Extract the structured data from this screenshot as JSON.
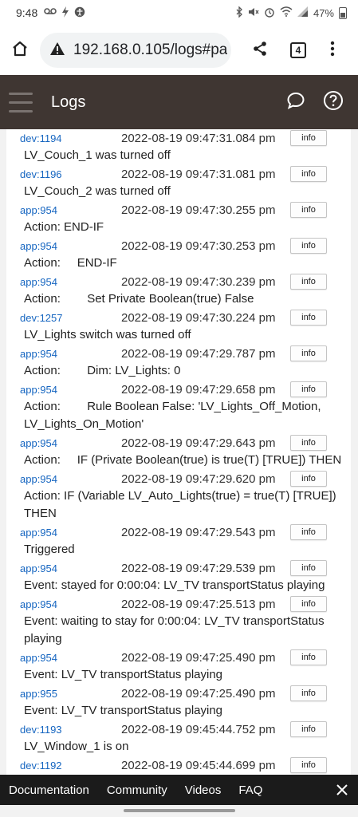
{
  "status": {
    "time": "9:48",
    "battery": "47%",
    "left_icons": [
      "voicemail-icon",
      "bolt-icon",
      "accessibility-icon"
    ],
    "right_icons": [
      "bluetooth-icon",
      "mute-icon",
      "alarm-icon",
      "wifi-icon",
      "signal-icon"
    ]
  },
  "browser": {
    "url": "192.168.0.105/logs#pa",
    "tab_count": "4"
  },
  "app": {
    "title": "Logs"
  },
  "logs": [
    {
      "src": "dev:1194",
      "ts": "2022-08-19 09:47:31.084 pm",
      "level": "info",
      "msg": "LV_Couch_1 was turned off"
    },
    {
      "src": "dev:1196",
      "ts": "2022-08-19 09:47:31.081 pm",
      "level": "info",
      "msg": "LV_Couch_2 was turned off"
    },
    {
      "src": "app:954",
      "ts": "2022-08-19 09:47:30.255 pm",
      "level": "info",
      "msg": "Action: END-IF"
    },
    {
      "src": "app:954",
      "ts": "2022-08-19 09:47:30.253 pm",
      "level": "info",
      "msg": "Action:     END-IF"
    },
    {
      "src": "app:954",
      "ts": "2022-08-19 09:47:30.239 pm",
      "level": "info",
      "msg": "Action:        Set Private Boolean(true) False"
    },
    {
      "src": "dev:1257",
      "ts": "2022-08-19 09:47:30.224 pm",
      "level": "info",
      "msg": "LV_Lights switch was turned off"
    },
    {
      "src": "app:954",
      "ts": "2022-08-19 09:47:29.787 pm",
      "level": "info",
      "msg": "Action:        Dim: LV_Lights: 0"
    },
    {
      "src": "app:954",
      "ts": "2022-08-19 09:47:29.658 pm",
      "level": "info",
      "msg": "Action:        Rule Boolean False: 'LV_Lights_Off_Motion, LV_Lights_On_Motion'"
    },
    {
      "src": "app:954",
      "ts": "2022-08-19 09:47:29.643 pm",
      "level": "info",
      "msg": "Action:     IF (Private Boolean(true) is true(T) [TRUE]) THEN"
    },
    {
      "src": "app:954",
      "ts": "2022-08-19 09:47:29.620 pm",
      "level": "info",
      "msg": "Action: IF (Variable LV_Auto_Lights(true) = true(T) [TRUE]) THEN"
    },
    {
      "src": "app:954",
      "ts": "2022-08-19 09:47:29.543 pm",
      "level": "info",
      "msg": "Triggered"
    },
    {
      "src": "app:954",
      "ts": "2022-08-19 09:47:29.539 pm",
      "level": "info",
      "msg": "Event: stayed for 0:00:04: LV_TV transportStatus playing"
    },
    {
      "src": "app:954",
      "ts": "2022-08-19 09:47:25.513 pm",
      "level": "info",
      "msg": "Event: waiting to stay for 0:00:04: LV_TV transportStatus playing"
    },
    {
      "src": "app:954",
      "ts": "2022-08-19 09:47:25.490 pm",
      "level": "info",
      "msg": "Event: LV_TV transportStatus playing"
    },
    {
      "src": "app:955",
      "ts": "2022-08-19 09:47:25.490 pm",
      "level": "info",
      "msg": "Event: LV_TV transportStatus playing"
    },
    {
      "src": "dev:1193",
      "ts": "2022-08-19 09:45:44.752 pm",
      "level": "info",
      "msg": "LV_Window_1 is on"
    },
    {
      "src": "dev:1192",
      "ts": "2022-08-19 09:45:44.699 pm",
      "level": "info",
      "msg": ""
    }
  ],
  "footer": {
    "links": [
      "Documentation",
      "Community",
      "Videos",
      "FAQ"
    ]
  }
}
